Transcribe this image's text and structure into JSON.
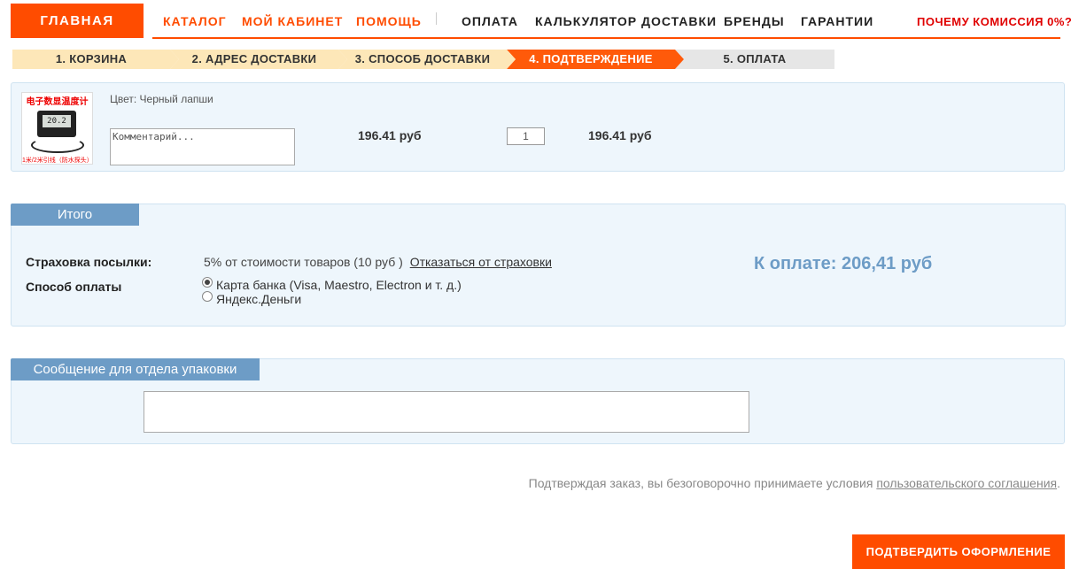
{
  "nav": {
    "home": "ГЛАВНАЯ",
    "catalog": "КАТАЛОГ",
    "cabinet": "МОЙ КАБИНЕТ",
    "help": "ПОМОЩЬ",
    "payment": "ОПЛАТА",
    "calculator": "КАЛЬКУЛЯТОР ДОСТАВКИ",
    "brands": "БРЕНДЫ",
    "guarantees": "ГАРАНТИИ",
    "commission": "ПОЧЕМУ КОМИССИЯ 0%?"
  },
  "steps": [
    {
      "label": "1. КОРЗИНА",
      "state": "done"
    },
    {
      "label": "2. АДРЕС ДОСТАВКИ",
      "state": "done"
    },
    {
      "label": "3. СПОСОБ ДОСТАВКИ",
      "state": "done"
    },
    {
      "label": "4. ПОДТВЕРЖДЕНИЕ",
      "state": "active"
    },
    {
      "label": "5. ОПЛАТА",
      "state": "todo"
    }
  ],
  "item": {
    "image_caption_top": "电子数显温度计",
    "image_screen": "20.2",
    "image_caption_bottom": "1米/2米引线（防水探头）",
    "color": "Цвет: Черный лапши",
    "comment_placeholder": "Комментарий...",
    "price": "196.41 руб",
    "quantity": "1",
    "subtotal": "196.41 руб"
  },
  "summary": {
    "tab": "Итого",
    "insurance_label": "Страховка посылки:",
    "insurance_value": "5% от стоимости товаров (10 руб )",
    "insurance_cancel": "Отказаться от страховки",
    "payment_label": "Способ оплаты",
    "payment_options": [
      {
        "label": "Карта банка (Visa, Maestro, Electron и т. д.)",
        "checked": true
      },
      {
        "label": "Яндекс.Деньги",
        "checked": false
      }
    ],
    "total": "К оплате: 206,41 руб"
  },
  "packing": {
    "tab": "Сообщение для отдела упаковки",
    "message": ""
  },
  "agreement": {
    "text": "Подтверждая заказ, вы безоговорочно принимаете условия ",
    "link": "пользовательского соглашения",
    "end": "."
  },
  "confirm_button": "ПОДТВЕРДИТЬ ОФОРМЛЕНИЕ",
  "colors": {
    "accent": "#ff4c00",
    "panel_bg": "#eef6fc",
    "tab_blue": "#6d9cc6",
    "step_done": "#fde7b8",
    "step_todo": "#e6e6e6"
  }
}
